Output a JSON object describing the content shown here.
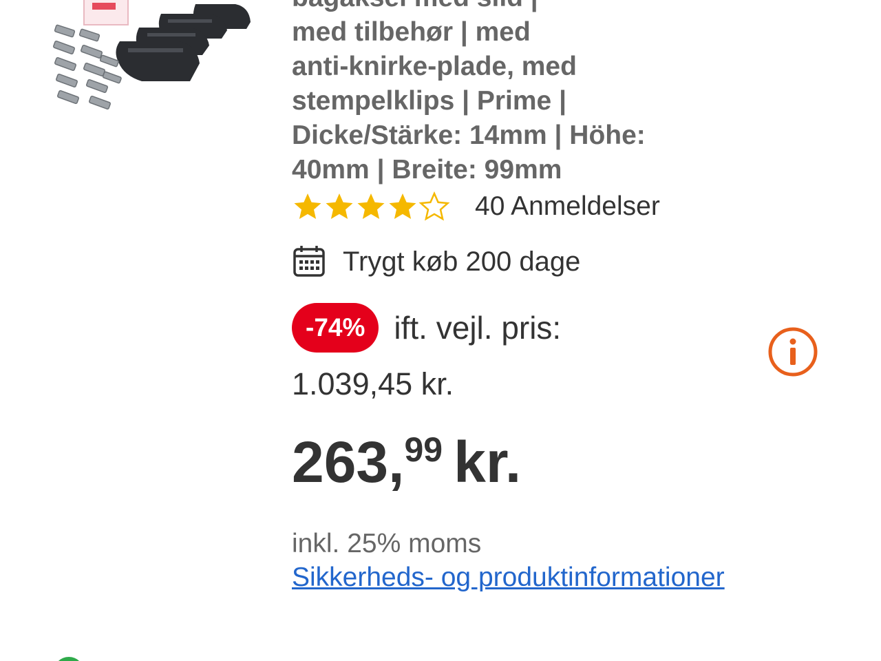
{
  "product": {
    "title_lines": [
      "bagaksel med slid |",
      "med tilbehør | med",
      "anti-knirke-plade, med",
      "stempelklips | Prime |",
      "Dicke/Stärke: 14mm | Höhe:",
      "40mm | Breite: 99mm"
    ],
    "image_icon": "brake-pads-product-photo"
  },
  "rating": {
    "value": 4,
    "max": 5,
    "reviews_label": "40 Anmeldelser",
    "star_color": "#f5b800"
  },
  "safe_buy": {
    "icon": "calendar-icon",
    "label": "Trygt køb 200 dage"
  },
  "pricing": {
    "discount_badge": "-74%",
    "rrp_label": "ift. vejl. pris:",
    "old_price": "1.039,45 kr.",
    "price_integer": "263,",
    "price_decimals": "99",
    "price_currency": "kr.",
    "vat_note": "inkl. 25% moms",
    "safety_link": "Sikkerheds- og produktinformationer",
    "badge_color": "#e4001b",
    "info_icon_color": "#e8601c",
    "link_color": "#2266cc"
  }
}
